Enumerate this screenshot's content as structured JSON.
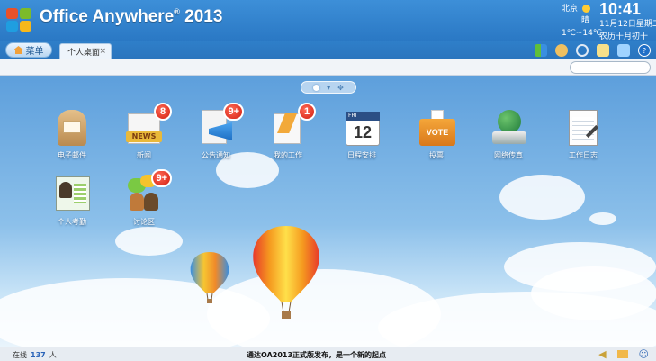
{
  "app": {
    "title": "Office Anywhere",
    "reg": "®",
    "year": "2013"
  },
  "weather": {
    "city": "北京",
    "condition": "晴",
    "temp": "1℃~14℃"
  },
  "clock": {
    "time": "10:41",
    "date": "11月12日星期二",
    "lunar": "农历十月初十"
  },
  "menu_label": "菜单",
  "tab": {
    "label": "个人桌面",
    "close": "×"
  },
  "icons": {
    "logo": "ms-logo-icon",
    "weather": "sun-icon",
    "grid": "grid-icon",
    "users": "users-icon",
    "settings": "gear-icon",
    "memo": "memo-icon",
    "theme": "theme-icon",
    "help": "help-icon"
  },
  "apps": [
    {
      "label": "电子邮件",
      "icon": "mail-icon"
    },
    {
      "label": "新闻",
      "icon": "news-icon",
      "badge": "8"
    },
    {
      "label": "公告通知",
      "icon": "megaphone-icon",
      "badge": "9+"
    },
    {
      "label": "我的工作",
      "icon": "work-icon",
      "badge": "1"
    },
    {
      "label": "日程安排",
      "icon": "calendar-icon",
      "cal_day": "12",
      "cal_head": "FRI"
    },
    {
      "label": "投票",
      "icon": "vote-icon",
      "box_text": "VOTE"
    },
    {
      "label": "网络传真",
      "icon": "fax-icon"
    },
    {
      "label": "工作日志",
      "icon": "journal-icon"
    },
    {
      "label": "个人考勤",
      "icon": "attendance-icon"
    },
    {
      "label": "讨论区",
      "icon": "forum-icon",
      "badge": "9+"
    }
  ],
  "status": {
    "online_label": "在线",
    "online_count": "137",
    "online_unit": "人",
    "notice": "通达OA2013正式版发布，是一个新的起点"
  },
  "colors": {
    "accent": "#2a78c4",
    "badge": "#d21d10"
  }
}
